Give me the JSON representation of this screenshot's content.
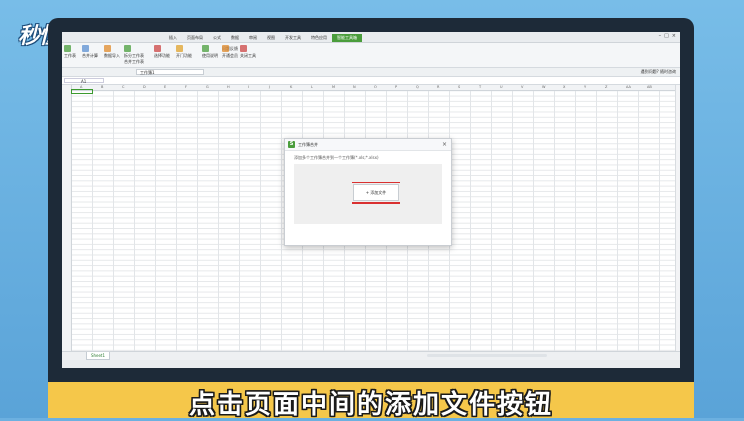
{
  "brand": {
    "logo_text": "秒懂视频"
  },
  "app": {
    "menu": [
      "插入",
      "页面布局",
      "公式",
      "数据",
      "审阅",
      "视图",
      "开发工具",
      "特色应用",
      "智能工具箱"
    ],
    "active_menu": "智能工具箱",
    "ribbon": {
      "items": [
        "工作表",
        "合并计算",
        "数据导入",
        "拆分工作表",
        "合并工作表",
        "选择功能",
        "开门功能",
        "使用说明",
        "问题反馈",
        "开通会员",
        "关闭工具"
      ]
    },
    "tab_name": "工作簿1",
    "right_info": "遇到问题? 随时咨询",
    "name_box": "A1",
    "sheet_tab": "Sheet1",
    "columns": [
      "A",
      "B",
      "C",
      "D",
      "E",
      "F",
      "G",
      "H",
      "I",
      "J",
      "K",
      "L",
      "M",
      "N",
      "O",
      "P",
      "Q",
      "R",
      "S",
      "T",
      "U",
      "V",
      "W",
      "X",
      "Y",
      "Z",
      "AA",
      "AB"
    ]
  },
  "dialog": {
    "title": "工作簿合并",
    "description": "添加多个工作簿合并到一个工作簿(*.xls;*.xlsx)",
    "add_button": "添加文件",
    "close_glyph": "×"
  },
  "caption": "点击页面中间的添加文件按钮",
  "colors": {
    "accent": "#4a9d3c",
    "highlight": "#d93030",
    "caption_bg": "#f5c74a"
  }
}
